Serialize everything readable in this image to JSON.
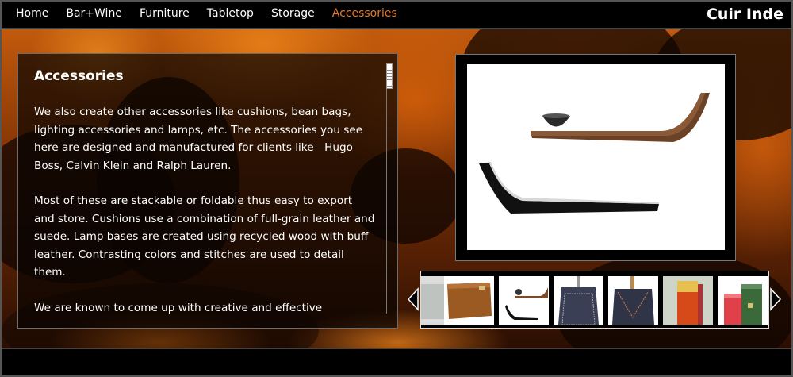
{
  "nav": {
    "items": [
      {
        "label": "Home",
        "active": false
      },
      {
        "label": "Bar+Wine",
        "active": false
      },
      {
        "label": "Furniture",
        "active": false
      },
      {
        "label": "Tabletop",
        "active": false
      },
      {
        "label": "Storage",
        "active": false
      },
      {
        "label": "Accessories",
        "active": true
      }
    ],
    "active_color": "#e87722"
  },
  "brand": "Cuir Inde",
  "content": {
    "title": "Accessories",
    "paragraphs": [
      "We also create other accessories like cushions, bean bags, lighting accessories and lamps, etc. The accessories you see here are designed and manufactured for clients like—Hugo Boss, Calvin Klein and Ralph Lauren.",
      "Most of these are stackable or foldable thus easy to export and store. Cushions use a combination of full-grain leather and suede. Lamp bases are created using recycled wood with buff leather. Contrasting colors and stitches are used to detail them.",
      "We are known to come up with creative and effective"
    ]
  },
  "gallery": {
    "main_image_icon": "bent-tray-product-image",
    "thumbnails": [
      {
        "icon": "grey-product-thumb"
      },
      {
        "icon": "leather-folder-thumb"
      },
      {
        "icon": "bent-tray-thumb"
      },
      {
        "icon": "navy-lamp-base-thumb"
      },
      {
        "icon": "stitched-lamp-base-thumb"
      },
      {
        "icon": "orange-block-thumb"
      },
      {
        "icon": "red-green-blocks-thumb"
      }
    ],
    "left_arrow_icon": "chevron-left-icon",
    "right_arrow_icon": "chevron-right-icon"
  },
  "colors": {
    "accent": "#e87722",
    "sunset": "#c25a0c"
  }
}
